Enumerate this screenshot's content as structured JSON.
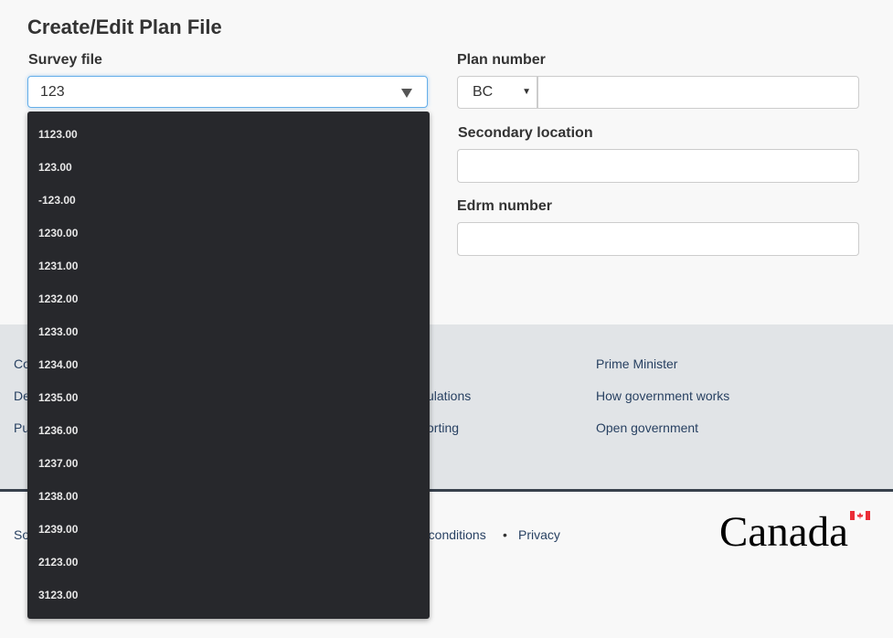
{
  "form": {
    "title": "Create/Edit Plan File",
    "survey_file": {
      "label": "Survey file",
      "value": "123",
      "options": [
        "1123.00",
        "123.00",
        "-123.00",
        "1230.00",
        "1231.00",
        "1232.00",
        "1233.00",
        "1234.00",
        "1235.00",
        "1236.00",
        "1237.00",
        "1238.00",
        "1239.00",
        "2123.00",
        "3123.00"
      ]
    },
    "plan_number": {
      "label": "Plan number",
      "prefix": "BC",
      "value": ""
    },
    "secondary_location": {
      "label": "Secondary location",
      "value": ""
    },
    "edrm_number": {
      "label": "Edrm number",
      "value": ""
    }
  },
  "footer": {
    "col1": [
      "Co",
      "De",
      "Pu"
    ],
    "col2": [
      "ulations",
      "orting"
    ],
    "col3": [
      "Prime Minister",
      "How government works",
      "Open government"
    ],
    "bottom": {
      "left": "So",
      "terms": "d conditions",
      "separator": "•",
      "privacy": "Privacy"
    },
    "wordmark": "Canada",
    "flag_color": "#eb2d37"
  }
}
